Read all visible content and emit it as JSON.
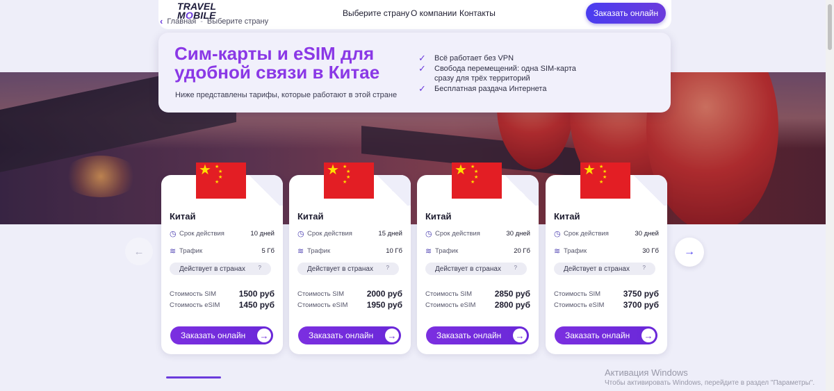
{
  "header": {
    "logo_line1": "TRAVEL",
    "logo_line2_a": "M",
    "logo_line2_o": "O",
    "logo_line2_b": "BILE",
    "breadcrumb": [
      "Главная",
      "Выберите страну"
    ],
    "nav": [
      "Выберите страну",
      "О компании",
      "Контакты"
    ],
    "cta": "Заказать онлайн"
  },
  "hero": {
    "title": "Сим-карты и eSIM для удобной связи в Китае",
    "subtitle": "Ниже представлены тарифы, которые работают в этой стране",
    "features": [
      "Всё работает без VPN",
      "Свобода перемещений: одна SIM-карта сразу для трёх территорий",
      "Бесплатная раздача Интернета"
    ]
  },
  "cards": [
    {
      "country": "Китай",
      "validity_label": "Срок действия",
      "validity": "10 дней",
      "traffic_label": "Трафик",
      "traffic": "5 Гб",
      "countries_label": "Действует в странах",
      "sim_label": "Стоимость SIM",
      "sim_price": "1500 руб",
      "esim_label": "Стоимость eSIM",
      "esim_price": "1450 руб",
      "order": "Заказать онлайн"
    },
    {
      "country": "Китай",
      "validity_label": "Срок действия",
      "validity": "15 дней",
      "traffic_label": "Трафик",
      "traffic": "10 Гб",
      "countries_label": "Действует в странах",
      "sim_label": "Стоимость SIM",
      "sim_price": "2000 руб",
      "esim_label": "Стоимость eSIM",
      "esim_price": "1950 руб",
      "order": "Заказать онлайн"
    },
    {
      "country": "Китай",
      "validity_label": "Срок действия",
      "validity": "30 дней",
      "traffic_label": "Трафик",
      "traffic": "20 Гб",
      "countries_label": "Действует в странах",
      "sim_label": "Стоимость SIM",
      "sim_price": "2850 руб",
      "esim_label": "Стоимость eSIM",
      "esim_price": "2800 руб",
      "order": "Заказать онлайн"
    },
    {
      "country": "Китай",
      "validity_label": "Срок действия",
      "validity": "30 дней",
      "traffic_label": "Трафик",
      "traffic": "30 Гб",
      "countries_label": "Действует в странах",
      "sim_label": "Стоимость SIM",
      "sim_price": "3750 руб",
      "esim_label": "Стоимость eSIM",
      "esim_price": "3700 руб",
      "order": "Заказать онлайн"
    }
  ],
  "icons": {
    "back": "chevron-left-icon",
    "check": "check-icon",
    "clock": "clock-icon",
    "wifi": "wifi-icon",
    "help": "question-icon",
    "arrow": "arrow-right-icon"
  },
  "colors": {
    "accent": "#6b3bdc",
    "title": "#8a38e6",
    "cta": "#4a3df0"
  },
  "watermark": {
    "line1": "Активация Windows",
    "line2": "Чтобы активировать Windows, перейдите в раздел \"Параметры\"."
  }
}
